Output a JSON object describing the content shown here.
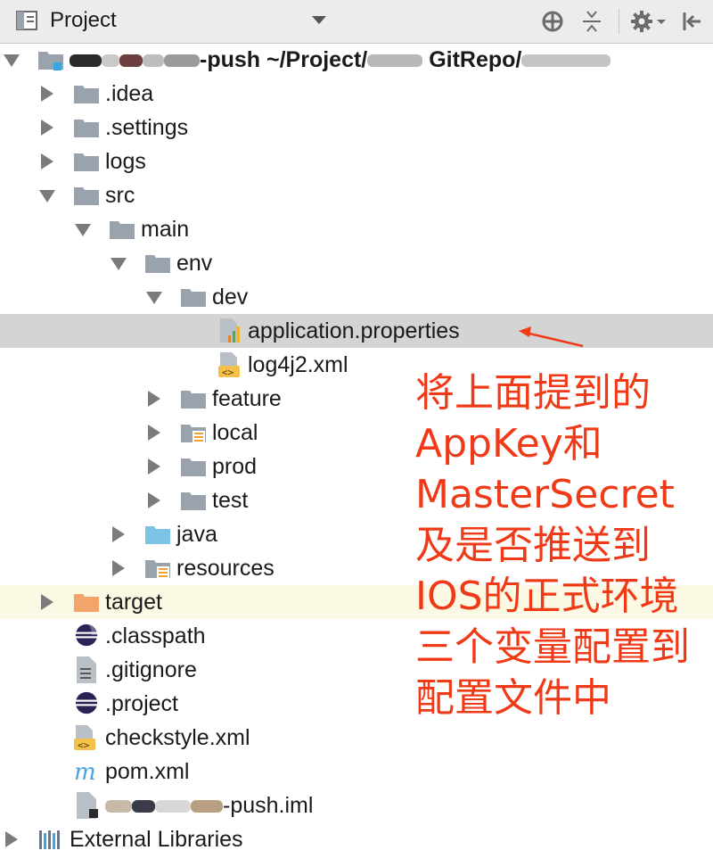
{
  "toolbar": {
    "title": "Project",
    "icons": [
      "project-view-icon",
      "dropdown-chevron-icon",
      "locate-target-icon",
      "collapse-all-icon",
      "gear-settings-icon",
      "hide-panel-icon"
    ]
  },
  "tree": {
    "root": {
      "name_suffix": "-push",
      "path_prefix": "~/Project/",
      "path_mid": "GitRepo/"
    },
    "items": [
      {
        "label": ".idea"
      },
      {
        "label": ".settings"
      },
      {
        "label": "logs"
      },
      {
        "label": "src"
      },
      {
        "label": "main"
      },
      {
        "label": "env"
      },
      {
        "label": "dev"
      },
      {
        "label": "application.properties"
      },
      {
        "label": "log4j2.xml"
      },
      {
        "label": "feature"
      },
      {
        "label": "local"
      },
      {
        "label": "prod"
      },
      {
        "label": "test"
      },
      {
        "label": "java"
      },
      {
        "label": "resources"
      },
      {
        "label": "target"
      },
      {
        "label": ".classpath"
      },
      {
        "label": ".gitignore"
      },
      {
        "label": ".project"
      },
      {
        "label": "checkstyle.xml"
      },
      {
        "label": "pom.xml"
      },
      {
        "label": "-push.iml"
      },
      {
        "label": "External Libraries"
      }
    ]
  },
  "annotation": {
    "text": "将上面提到的\nAppKey和\nMasterSecret\n及是否推送到\nIOS的正式环境\n三个变量配置到\n配置文件中"
  },
  "colors": {
    "annotation": "#f03a17",
    "folder": "#9aa3ad",
    "source_folder": "#7ec3e6",
    "excluded_folder": "#f2a46b",
    "selected_row": "#d4d4d4"
  }
}
